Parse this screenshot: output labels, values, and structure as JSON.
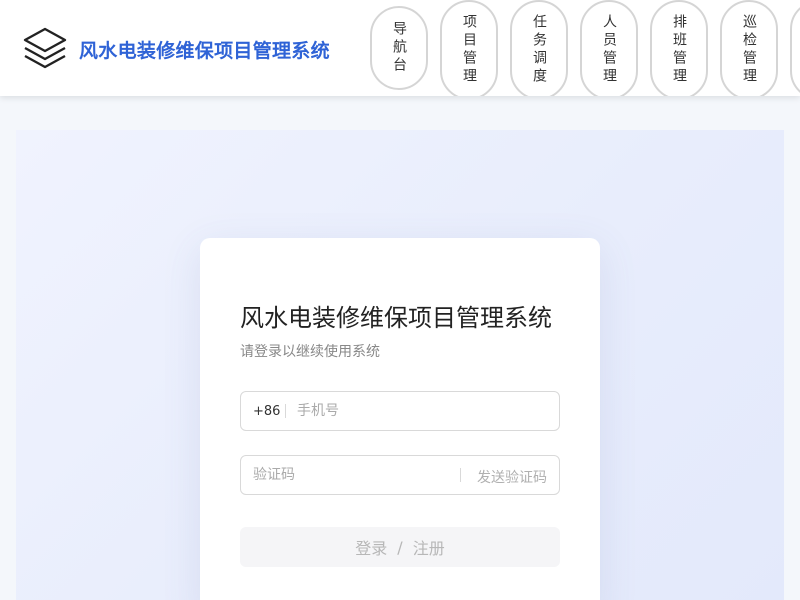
{
  "header": {
    "logo_icon": "layers-icon",
    "app_title": "风水电装修维保项目管理系统",
    "nav_items": [
      {
        "label": "导航台"
      },
      {
        "label": "项目管理"
      },
      {
        "label": "任务调度"
      },
      {
        "label": "人员管理"
      },
      {
        "label": "排班管理"
      },
      {
        "label": "巡检管理"
      }
    ]
  },
  "login": {
    "title": "风水电装修维保项目管理系统",
    "subtitle": "请登录以继续使用系统",
    "phone": {
      "prefix": "+86",
      "placeholder": "手机号",
      "value": ""
    },
    "code": {
      "placeholder": "验证码",
      "value": "",
      "send_label": "发送验证码"
    },
    "submit": {
      "login_label": "登录",
      "separator": "/",
      "register_label": "注册"
    }
  },
  "colors": {
    "brand": "#2f63d6",
    "background": "#f4f7fb",
    "button_disabled": "#f5f5f7"
  }
}
